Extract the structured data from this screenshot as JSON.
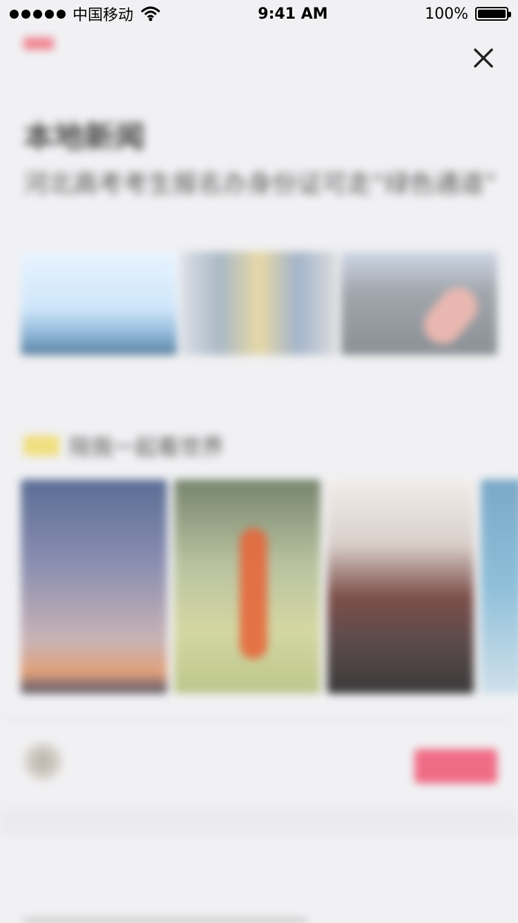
{
  "status_bar": {
    "carrier": "中国移动",
    "time": "9:41 AM",
    "battery": "100%"
  },
  "close_button": {
    "icon": "close-icon"
  },
  "top_meta": {
    "tag": "",
    "source": "",
    "comments": "",
    "time": ""
  },
  "section": {
    "title": "本地新闻",
    "tabs": [
      "",
      "",
      ""
    ]
  },
  "article": {
    "headline": "河北高考考生报名办身份证可走“绿色通道”",
    "meta": ""
  },
  "recommend": {
    "title": "陪我一起看世界",
    "more": ""
  },
  "author": {
    "name": "",
    "sub": "",
    "follow_label": ""
  },
  "bottom_article": {
    "headline": "",
    "right_text": ""
  }
}
